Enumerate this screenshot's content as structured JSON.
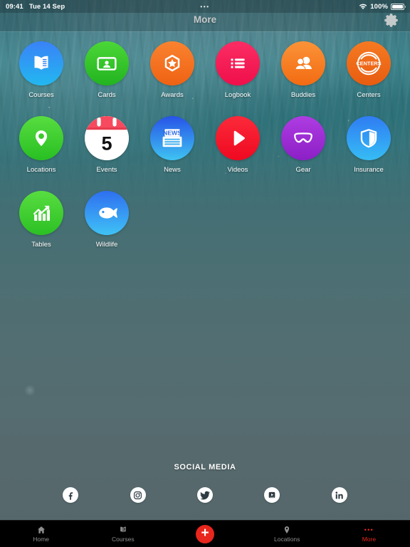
{
  "status_bar": {
    "time": "09:41",
    "date": "Tue 14 Sep",
    "multitask_dots": "•••",
    "battery_percent": "100%",
    "wifi_icon": "wifi-icon",
    "battery_icon": "battery-icon"
  },
  "header": {
    "title": "More",
    "settings_icon": "gear-icon"
  },
  "grid": {
    "items": [
      {
        "label": "Courses",
        "icon": "book-icon",
        "color": "#1f9ff0"
      },
      {
        "label": "Cards",
        "icon": "id-card-icon",
        "color": "#34c628"
      },
      {
        "label": "Awards",
        "icon": "award-star-icon",
        "color": "#f2711c"
      },
      {
        "label": "Logbook",
        "icon": "list-icon",
        "color": "#f42057"
      },
      {
        "label": "Buddies",
        "icon": "people-icon",
        "color": "#f5801e"
      },
      {
        "label": "Centers",
        "icon": "centers-icon",
        "color": "#ef6c1a"
      },
      {
        "label": "Locations",
        "icon": "map-pin-icon",
        "color": "#3fcd2d"
      },
      {
        "label": "Events",
        "icon": "calendar-icon",
        "color": "#f8475e"
      },
      {
        "label": "News",
        "icon": "newspaper-icon",
        "color": "#2f7df0"
      },
      {
        "label": "Videos",
        "icon": "play-icon",
        "color": "#f4172e"
      },
      {
        "label": "Gear",
        "icon": "dive-mask-icon",
        "color": "#a132d6"
      },
      {
        "label": "Insurance",
        "icon": "shield-icon",
        "color": "#1a7ff0"
      },
      {
        "label": "Tables",
        "icon": "growth-chart-icon",
        "color": "#44cc30"
      },
      {
        "label": "Wildlife",
        "icon": "fish-icon",
        "color": "#2f8ef5"
      }
    ],
    "centers_text": "CENTERS",
    "events_day": "5",
    "news_text": "NEWS"
  },
  "social": {
    "title": "SOCIAL MEDIA",
    "items": [
      {
        "name": "facebook",
        "icon": "facebook-icon"
      },
      {
        "name": "instagram",
        "icon": "instagram-icon"
      },
      {
        "name": "twitter",
        "icon": "twitter-icon"
      },
      {
        "name": "youtube",
        "icon": "youtube-icon"
      },
      {
        "name": "linkedin",
        "icon": "linkedin-icon"
      }
    ]
  },
  "tabbar": {
    "active_color": "#e8261d",
    "inactive_color": "#8e8e8e",
    "tabs": [
      {
        "label": "Home",
        "icon": "home-icon",
        "active": false
      },
      {
        "label": "Courses",
        "icon": "book-icon",
        "active": false
      },
      {
        "label": "",
        "icon": "plus-icon",
        "active": false
      },
      {
        "label": "Locations",
        "icon": "map-pin-icon",
        "active": false
      },
      {
        "label": "More",
        "icon": "more-dots-icon",
        "active": true
      }
    ],
    "add_label": "+",
    "more_dots": "•••"
  }
}
